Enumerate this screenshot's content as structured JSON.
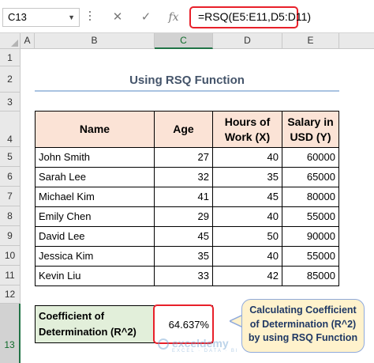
{
  "formula_bar": {
    "name_box": "C13",
    "cancel_icon": "✕",
    "enter_icon": "✓",
    "fx_label": "fx",
    "formula": "=RSQ(E5:E11,D5:D11)"
  },
  "columns": [
    "A",
    "B",
    "C",
    "D",
    "E"
  ],
  "selected_column": "C",
  "rows": [
    "1",
    "2",
    "3",
    "4",
    "5",
    "6",
    "7",
    "8",
    "9",
    "10",
    "11",
    "12",
    "13"
  ],
  "selected_row": "13",
  "sheet": {
    "title": "Using RSQ Function",
    "headers": [
      "Name",
      "Age",
      "Hours of Work (X)",
      "Salary in USD (Y)"
    ],
    "data": [
      [
        "John Smith",
        "27",
        "40",
        "60000"
      ],
      [
        "Sarah Lee",
        "32",
        "35",
        "65000"
      ],
      [
        "Michael Kim",
        "41",
        "45",
        "80000"
      ],
      [
        "Emily Chen",
        "29",
        "40",
        "55000"
      ],
      [
        "David Lee",
        "45",
        "50",
        "90000"
      ],
      [
        "Jessica Kim",
        "35",
        "40",
        "55000"
      ],
      [
        "Kevin Liu",
        "33",
        "42",
        "85000"
      ]
    ],
    "coef_label": "Coefficient of Determination (R^2)",
    "coef_value": "64.637%"
  },
  "callout": {
    "text": "Calculating Coefficient of Determination (R^2) by using RSQ Function"
  },
  "watermark": {
    "brand": "exceldemy",
    "tagline": "EXCEL · DATA · BI"
  },
  "colors": {
    "header_fill": "#fbe3d6",
    "coef_fill": "#e2efda",
    "highlight_border": "#e8202a",
    "callout_fill": "#fff2cc",
    "callout_border": "#8faadc",
    "title_color": "#44546a"
  }
}
